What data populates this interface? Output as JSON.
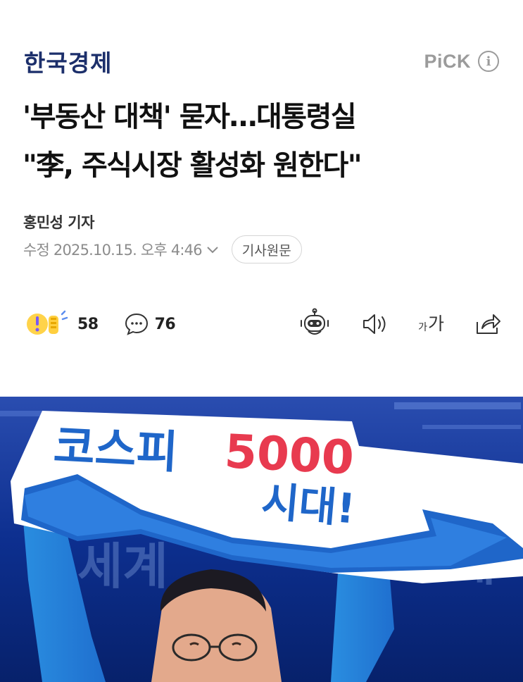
{
  "publisher": {
    "name": "한국경제",
    "pick_label": "PiCK",
    "info_icon": "info-icon"
  },
  "article": {
    "headline_line1": "'부동산 대책' 묻자…대통령실",
    "headline_line2": "\"李, 주식시장 활성화 원한다\"",
    "reporter": "홍민성 기자",
    "modified": "수정 2025.10.15. 오후 4:46",
    "original_button": "기사원문"
  },
  "reactions": {
    "reaction_count": "58",
    "comment_count": "76"
  },
  "tools": {
    "font_small": "가",
    "font_big": "가",
    "icons": [
      "robot-summary-icon",
      "speaker-icon",
      "font-size-icon",
      "share-icon"
    ]
  },
  "photo": {
    "sign_word": "코스피",
    "sign_number": "5000",
    "sign_sub": "시대!",
    "colors": {
      "sign_blue": "#1f66c9",
      "sign_red": "#e83a4f",
      "stage_blue": "#0b2a86"
    }
  }
}
